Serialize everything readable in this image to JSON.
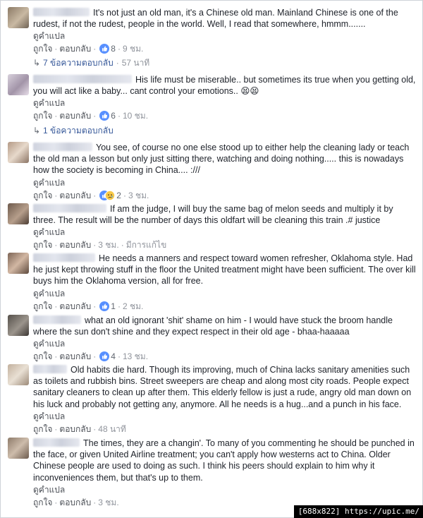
{
  "labels": {
    "see_translation": "ดูคำแปล",
    "like": "ถูกใจ",
    "reply": "ตอบกลับ",
    "edited": "มีการแก้ไข",
    "dot": "·"
  },
  "comments": [
    {
      "text": "It's not just an old man, it's a Chinese old man. Mainland Chinese is one of the rudest, if not the rudest, people in the world. Well, I read that somewhere, hmmm.......",
      "reaction_icon": "like-icon",
      "reaction_count": "8",
      "time": "9 ชม.",
      "replies": {
        "label": "7 ข้อความตอบกลับ",
        "time": "57 นาที"
      }
    },
    {
      "text": "His life must be miserable.. but sometimes its true when you getting old, you will act like a baby... cant control your emotions..",
      "emoji": "😫😫",
      "reaction_icon": "like-icon",
      "reaction_count": "6",
      "time": "10 ชม.",
      "replies": {
        "label": "1 ข้อความตอบกลับ"
      }
    },
    {
      "text": "You see, of course no one else stood up to either help the cleaning lady or teach the old man a lesson but only just sitting there, watching and doing nothing..... this is nowadays how the society is becoming in China.... :///",
      "reaction_icon": "like-sad-icons",
      "reaction_count": "2",
      "time": "3 ชม."
    },
    {
      "text": "If am the judge, I will buy the same bag of melon seeds and multiply it by three. The result will be the number of days this oldfart will be cleaning this train .# justice",
      "time": "3 ชม.",
      "edited": true
    },
    {
      "text": "He needs a manners and respect toward women refresher, Oklahoma style. Had he just kept throwing stuff in the floor the United treatment might have been sufficient. The over kill buys him the Oklahoma version, all for free.",
      "reaction_icon": "like-icon",
      "reaction_count": "1",
      "time": "2 ชม."
    },
    {
      "text": "what an old ignorant 'shit' shame on him - I would have stuck the broom handle where the sun don't shine and they expect respect in their old age - bhaa-haaaaa",
      "reaction_icon": "like-icon",
      "reaction_count": "4",
      "time": "13 ชม."
    },
    {
      "text": "Old habits die hard. Though its improving, much of China lacks sanitary amenities such as toilets and rubbish bins. Street sweepers are cheap and along most city roads. People expect sanitary cleaners to clean up after them. This elderly fellow is just a rude, angry old man down on his luck and probably not getting any, anymore. All he needs is a hug...and a punch in his face.",
      "time": "48 นาที"
    },
    {
      "text": "The times, they are a changin'. To many of you commenting he should be punched in the face, or given United Airline treatment; you can't apply how westerns act to China. Older Chinese people are used to doing as such. I think his peers should explain to him why it inconveniences them, but that's up to them.",
      "time": "3 ชม."
    }
  ],
  "watermark": "[688x822] https://upic.me/",
  "colors": {
    "like_blue": "#5890ff",
    "link": "#365899",
    "meta": "#90949c"
  }
}
